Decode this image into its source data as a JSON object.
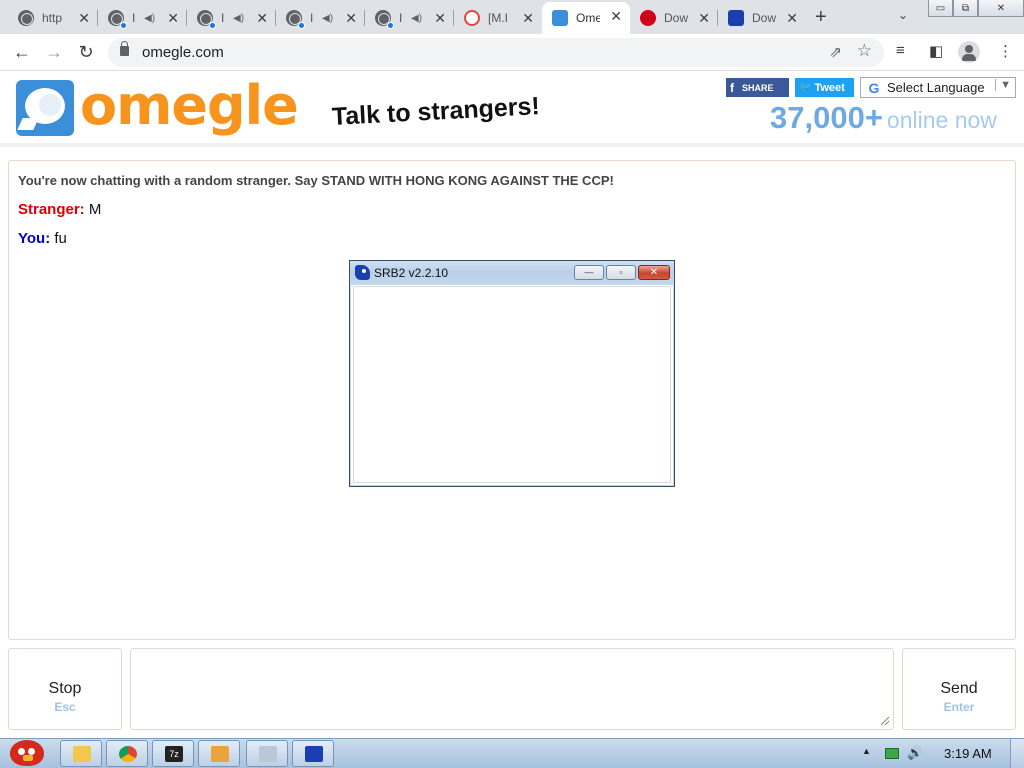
{
  "browser": {
    "tabs": [
      {
        "title": "http",
        "audio": false
      },
      {
        "title": "I",
        "audio": true
      },
      {
        "title": "I",
        "audio": true
      },
      {
        "title": "I",
        "audio": true
      },
      {
        "title": "I",
        "audio": true
      },
      {
        "title": "[M.I",
        "audio": false
      },
      {
        "title": "Ome",
        "audio": false
      },
      {
        "title": "Dow",
        "audio": false
      },
      {
        "title": "Dow",
        "audio": false
      }
    ],
    "close_glyph": "✕",
    "new_tab_glyph": "+",
    "tab_menu_glyph": "⌄",
    "url": "omegle.com",
    "window_buttons": {
      "minimize": "▭",
      "restore": "⧉",
      "close": "✕"
    }
  },
  "site": {
    "logo_text": "omegle",
    "tagline": "Talk to strangers!",
    "fb_label": "SHARE",
    "fb_glyph": "f",
    "tweet_label": "Tweet",
    "language_label": "Select Language",
    "language_g": "G",
    "language_arrow": "▼",
    "online_count": "37,000+",
    "online_label": "online now"
  },
  "chat": {
    "status": "You're now chatting with a random stranger. Say STAND WITH HONG KONG AGAINST THE CCP!",
    "messages": [
      {
        "who": "Stranger:",
        "text": "M"
      },
      {
        "who": "You:",
        "text": "fu"
      }
    ]
  },
  "srb_window": {
    "title": "SRB2 v2.2.10",
    "min_glyph": "—",
    "max_glyph": "▫",
    "close_glyph": "✕"
  },
  "controls": {
    "stop_label": "Stop",
    "stop_hint": "Esc",
    "send_label": "Send",
    "send_hint": "Enter"
  },
  "taskbar": {
    "clock": "3:19 AM",
    "tray_arrow": "▲",
    "volume_glyph": "🔊",
    "items": [
      "explorer",
      "chrome",
      "7zip",
      "file-manager",
      "paint",
      "srb2"
    ]
  },
  "colors": {
    "omegle_orange": "#f7941d",
    "omegle_blue": "#3b8ed8",
    "stranger_red": "#dd0000",
    "you_blue": "#0000cc",
    "facebook_blue": "#3b5998",
    "twitter_blue": "#1da1f2"
  }
}
